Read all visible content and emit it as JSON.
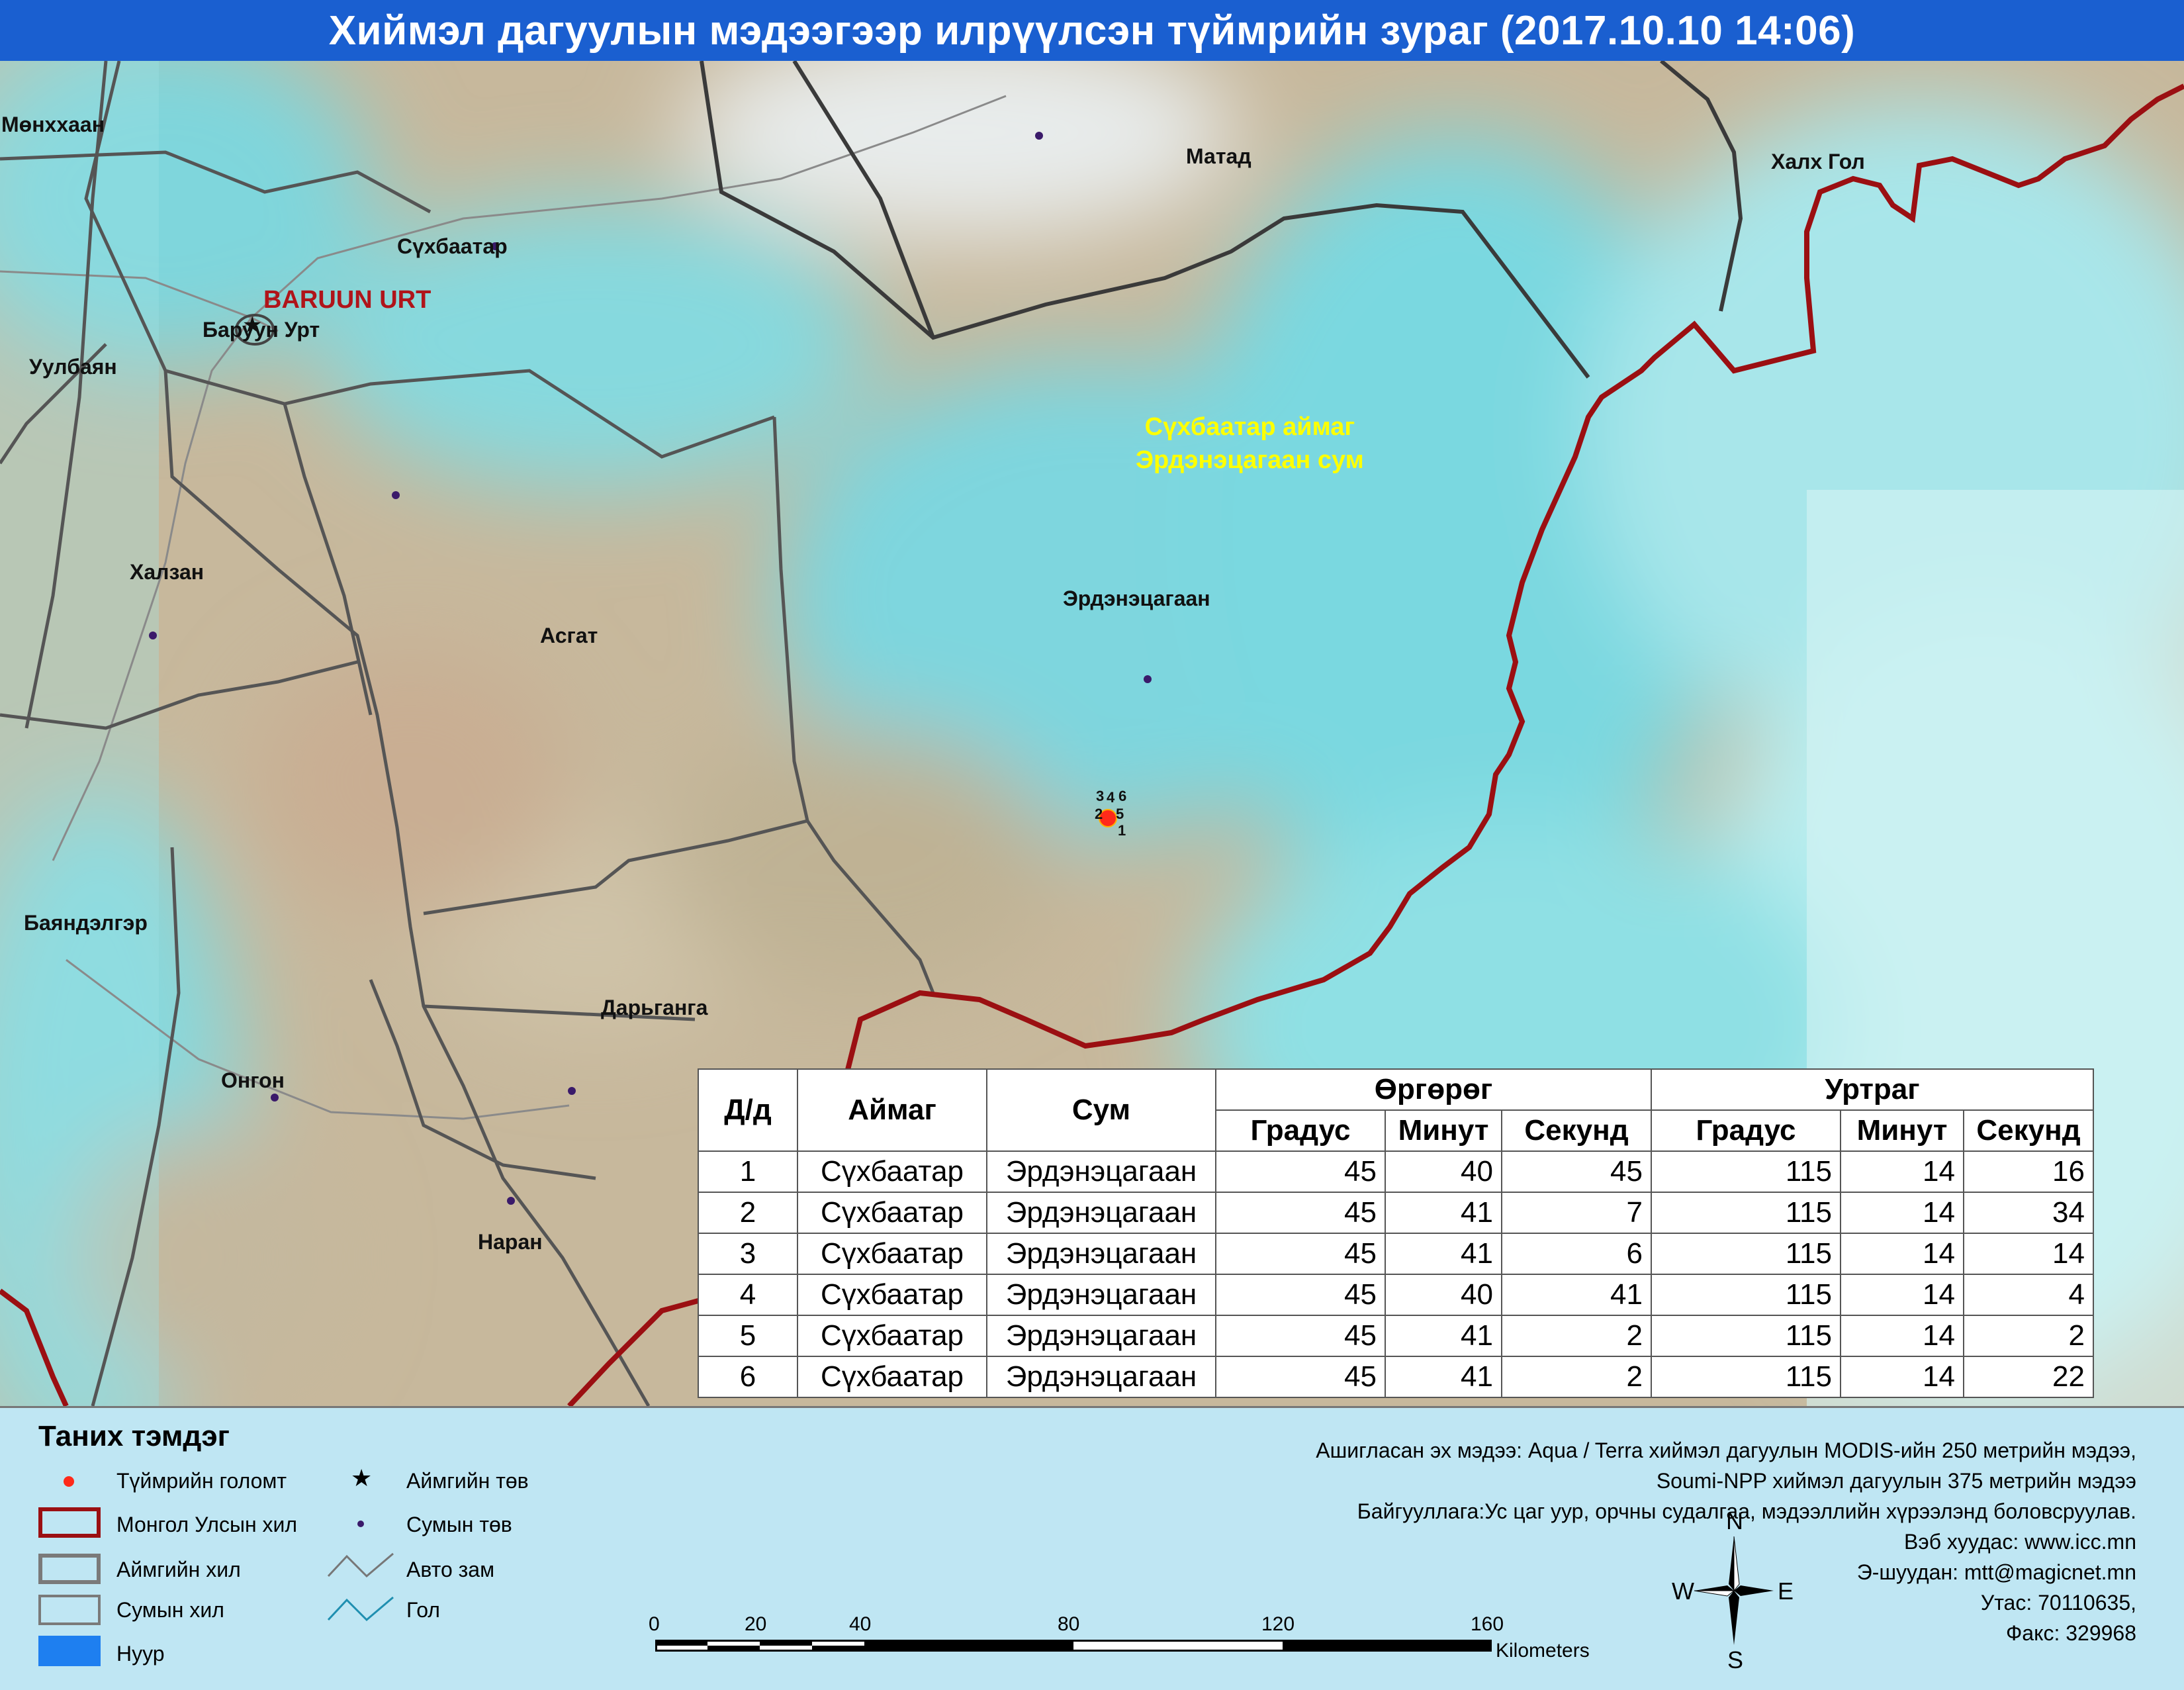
{
  "title": "Хиймэл дагуулын мэдээгээр илрүүлсэн түймрийн зураг  (2017.10.10 14:06)",
  "map_labels": {
    "monkhkhaan": "Мөнххаан",
    "matad": "Матад",
    "khalkh_gol": "Халх Гол",
    "sukhbaatar_sum": "Сүхбаатар",
    "baruun_urt_en": "BARUUN URT",
    "baruun_urt": "Баруун Урт",
    "uulbayan": "Уулбаян",
    "aimag_sum_line1": "Сүхбаатар аймаг",
    "aimag_sum_line2": "Эрдэнэцагаан сум",
    "khalzan": "Халзан",
    "asgat": "Асгат",
    "erdenetsagaan": "Эрдэнэцагаан",
    "bayandelger": "Баяндэлгэр",
    "dariganga": "Дарьганга",
    "ongon": "Онгон",
    "naran": "Наран"
  },
  "fire_numbers": [
    "3",
    "4",
    "6",
    "2",
    "5",
    "1"
  ],
  "table": {
    "headers": {
      "num": "Д/д",
      "aimag": "Аймаг",
      "sum": "Сум",
      "lat": "Өргөрөг",
      "lon": "Уртраг",
      "deg": "Градус",
      "min": "Минут",
      "sec": "Секунд"
    },
    "rows": [
      {
        "n": "1",
        "aimag": "Сүхбаатар",
        "sum": "Эрдэнэцагаан",
        "lat_d": "45",
        "lat_m": "40",
        "lat_s": "45",
        "lon_d": "115",
        "lon_m": "14",
        "lon_s": "16"
      },
      {
        "n": "2",
        "aimag": "Сүхбаатар",
        "sum": "Эрдэнэцагаан",
        "lat_d": "45",
        "lat_m": "41",
        "lat_s": "7",
        "lon_d": "115",
        "lon_m": "14",
        "lon_s": "34"
      },
      {
        "n": "3",
        "aimag": "Сүхбаатар",
        "sum": "Эрдэнэцагаан",
        "lat_d": "45",
        "lat_m": "41",
        "lat_s": "6",
        "lon_d": "115",
        "lon_m": "14",
        "lon_s": "14"
      },
      {
        "n": "4",
        "aimag": "Сүхбаатар",
        "sum": "Эрдэнэцагаан",
        "lat_d": "45",
        "lat_m": "40",
        "lat_s": "41",
        "lon_d": "115",
        "lon_m": "14",
        "lon_s": "4"
      },
      {
        "n": "5",
        "aimag": "Сүхбаатар",
        "sum": "Эрдэнэцагаан",
        "lat_d": "45",
        "lat_m": "41",
        "lat_s": "2",
        "lon_d": "115",
        "lon_m": "14",
        "lon_s": "2"
      },
      {
        "n": "6",
        "aimag": "Сүхбаатар",
        "sum": "Эрдэнэцагаан",
        "lat_d": "45",
        "lat_m": "41",
        "lat_s": "2",
        "lon_d": "115",
        "lon_m": "14",
        "lon_s": "22"
      }
    ]
  },
  "legend": {
    "title": "Таних тэмдэг",
    "fire": "Түймрийн голомт",
    "border": "Монгол Улсын хил",
    "aimag_border": "Аймгийн хил",
    "sum_border": "Сумын хил",
    "lake": "Нуур",
    "aimag_center": "Аймгийн төв",
    "sum_center": "Сумын төв",
    "road": "Авто зам",
    "river": "Гол"
  },
  "scale": {
    "ticks": [
      "0",
      "20",
      "40",
      "80",
      "120",
      "160"
    ],
    "unit": "Kilometers"
  },
  "compass": {
    "n": "N",
    "s": "S",
    "e": "E",
    "w": "W"
  },
  "source": {
    "line1": "Ашигласан эх мэдээ: Aqua / Terra хиймэл дагуулын MODIS-ийн 250 метрийн мэдээ,",
    "line2": "Soumi-NPP хиймэл дагуулын 375 метрийн мэдээ",
    "line3": "Байгууллага:Ус цаг уур, орчны судалгаа, мэдээллийн хүрээлэнд боловсруулав.",
    "line4": "Вэб хуудас: www.icc.mn",
    "line5": "Э-шуудан: mtt@magicnet.mn",
    "line6": "Утас: 70110635,",
    "line7": "Факс: 329968"
  },
  "colors": {
    "title_bg": "#1a5fd0",
    "national_border": "#9b0f12",
    "aimag_border": "#3a3a3a",
    "sum_border": "#555555",
    "fire": "#ff2a1a",
    "sum_center": "#3a1a6a",
    "legend_bg": "#bfe6f3"
  }
}
